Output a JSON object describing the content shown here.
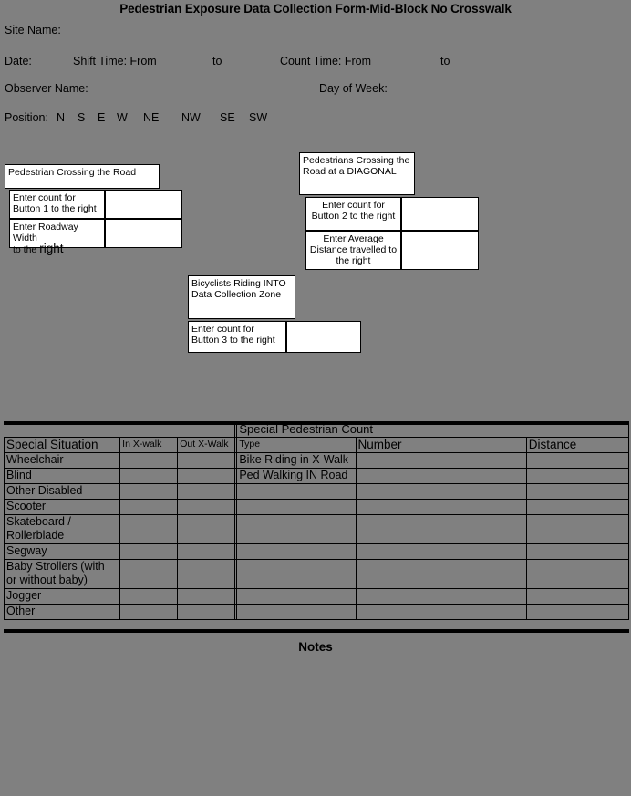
{
  "title": "Pedestrian Exposure Data Collection Form-Mid-Block No Crosswalk",
  "header": {
    "site_name": "Site Name:",
    "date": "Date:",
    "shift_time": "Shift Time: From",
    "shift_to": "to",
    "count_time": "Count Time: From",
    "count_to": "to",
    "observer_name": "Observer Name:",
    "day_of_week": "Day of Week:",
    "position": "Position:",
    "position_options": [
      "N",
      "S",
      "E",
      "W",
      "NE",
      "NW",
      "SE",
      "SW"
    ]
  },
  "ped_crossing_group": {
    "heading": "Pedestrian Crossing the Road",
    "rows": [
      {
        "label": "Enter count for Button 1 to the right",
        "value": ""
      },
      {
        "label_part1": "Enter Roadway Width",
        "label_part2": "to the ",
        "label_emph": "right",
        "value": ""
      }
    ]
  },
  "diagonal_group": {
    "heading": "Pedestrians Crossing the Road at a DIAGONAL",
    "rows": [
      {
        "label": "Enter count for Button 2 to the right",
        "value": ""
      },
      {
        "label": "Enter Average Distance travelled  to the right",
        "value": ""
      }
    ]
  },
  "bicyclist_group": {
    "heading": "Bicyclists Riding INTO Data Collection Zone",
    "rows": [
      {
        "label": "Enter count for Button 3 to the right",
        "value": ""
      }
    ]
  },
  "special_situation_table": {
    "columns": [
      "Special Situation",
      "In X-walk",
      "Out X-Walk"
    ],
    "rows": [
      {
        "name": "Wheelchair",
        "in_xwalk": "",
        "out_xwalk": ""
      },
      {
        "name": "Blind",
        "in_xwalk": "",
        "out_xwalk": ""
      },
      {
        "name": "Other Disabled",
        "in_xwalk": "",
        "out_xwalk": ""
      },
      {
        "name": "Scooter",
        "in_xwalk": "",
        "out_xwalk": ""
      },
      {
        "name": "Skateboard / Rollerblade",
        "in_xwalk": "",
        "out_xwalk": ""
      },
      {
        "name": "Segway",
        "in_xwalk": "",
        "out_xwalk": ""
      },
      {
        "name": "Baby Strollers (with or without baby)",
        "in_xwalk": "",
        "out_xwalk": ""
      },
      {
        "name": "Jogger",
        "in_xwalk": "",
        "out_xwalk": ""
      },
      {
        "name": "Other",
        "in_xwalk": "",
        "out_xwalk": ""
      }
    ]
  },
  "special_pedestrian_count": {
    "group_header": "Special Pedestrian Count",
    "columns": [
      "Type",
      "Number",
      "Distance"
    ],
    "rows": [
      {
        "type": "Bike Riding in X-Walk",
        "number": "",
        "distance": ""
      },
      {
        "type": "Ped Walking IN Road",
        "number": "",
        "distance": ""
      },
      {
        "type": "",
        "number": "",
        "distance": ""
      },
      {
        "type": "",
        "number": "",
        "distance": ""
      },
      {
        "type": "",
        "number": "",
        "distance": ""
      },
      {
        "type": "",
        "number": "",
        "distance": ""
      },
      {
        "type": "",
        "number": "",
        "distance": ""
      },
      {
        "type": "",
        "number": "",
        "distance": ""
      },
      {
        "type": "",
        "number": "",
        "distance": ""
      }
    ]
  },
  "notes": {
    "title": "Notes",
    "content": ""
  },
  "colors": {
    "background": "#808080",
    "box_fill": "#ffffff",
    "line": "#000000"
  }
}
